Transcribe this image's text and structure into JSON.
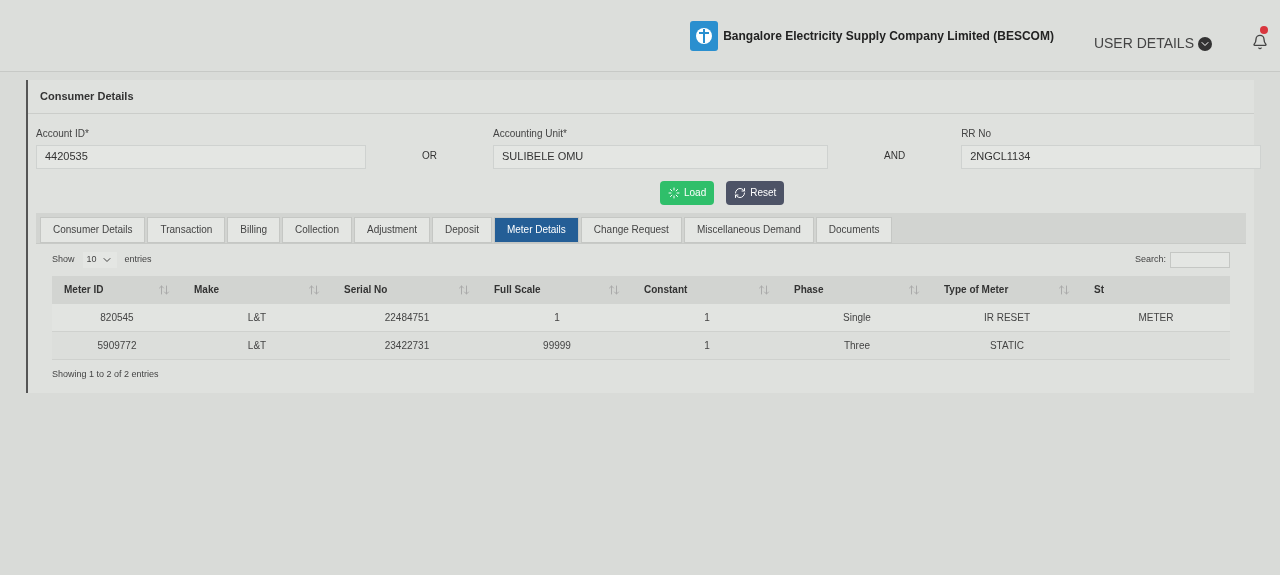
{
  "header": {
    "company": "Bangalore Electricity Supply Company Limited (BESCOM)",
    "user_menu": "USER DETAILS"
  },
  "panel": {
    "title": "Consumer Details"
  },
  "form": {
    "fields": [
      {
        "label": "Account ID*",
        "value": "4420535"
      },
      {
        "label": "Accounting Unit*",
        "value": "SULIBELE OMU"
      },
      {
        "label": "RR No",
        "value": "2NGCL1134"
      }
    ],
    "connectors": [
      "OR",
      "AND"
    ],
    "buttons": [
      {
        "label": "Load",
        "kind": "primary"
      },
      {
        "label": "Reset",
        "kind": "secondary"
      }
    ]
  },
  "tabs": [
    {
      "label": "Consumer Details",
      "selected": false
    },
    {
      "label": "Transaction",
      "selected": false
    },
    {
      "label": "Billing",
      "selected": false
    },
    {
      "label": "Collection",
      "selected": false
    },
    {
      "label": "Adjustment",
      "selected": false
    },
    {
      "label": "Deposit",
      "selected": false
    },
    {
      "label": "Meter Details",
      "selected": true
    },
    {
      "label": "Change Request",
      "selected": false
    },
    {
      "label": "Miscellaneous Demand",
      "selected": false
    },
    {
      "label": "Documents",
      "selected": false
    }
  ],
  "table": {
    "show_label": "Show",
    "page_size": "10",
    "entries_label": "entries",
    "search_label": "Search:",
    "columns": [
      "Meter ID",
      "Make",
      "Serial No",
      "Full Scale",
      "Constant",
      "Phase",
      "Type of Meter",
      "St"
    ],
    "rows": [
      [
        "820545",
        "L&T",
        "22484751",
        "1",
        "1",
        "Single",
        "IR RESET",
        "METER"
      ],
      [
        "5909772",
        "L&T",
        "23422731",
        "99999",
        "1",
        "Three",
        "STATIC",
        ""
      ]
    ],
    "footer": "Showing 1 to 2 of 2 entries"
  }
}
